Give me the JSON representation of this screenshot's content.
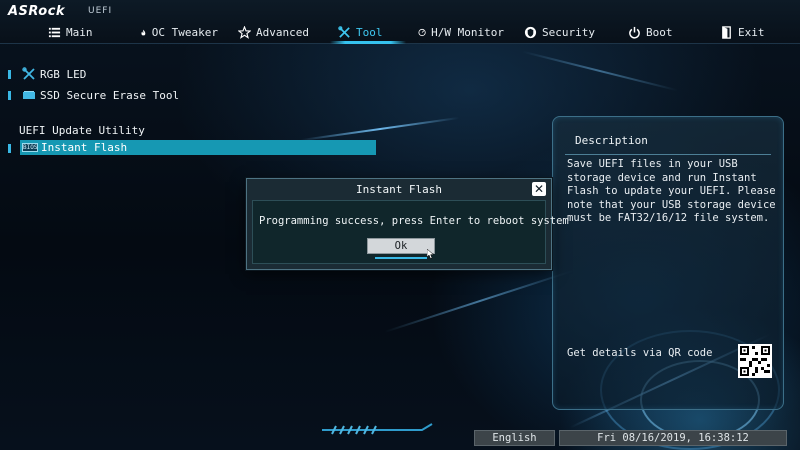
{
  "brand": {
    "name": "ASRock",
    "sub": "UEFI"
  },
  "tabs": [
    {
      "label": "Main",
      "icon": "list-icon"
    },
    {
      "label": "OC Tweaker",
      "icon": "flame-icon"
    },
    {
      "label": "Advanced",
      "icon": "star-icon"
    },
    {
      "label": "Tool",
      "icon": "tools-icon",
      "active": true
    },
    {
      "label": "H/W Monitor",
      "icon": "monitor-gauge-icon"
    },
    {
      "label": "Security",
      "icon": "shield-icon"
    },
    {
      "label": "Boot",
      "icon": "power-icon"
    },
    {
      "label": "Exit",
      "icon": "exit-door-icon"
    }
  ],
  "menu": {
    "items": [
      {
        "label": "RGB LED",
        "icon": "wrench-screwdriver-icon"
      },
      {
        "label": "SSD Secure Erase Tool",
        "icon": "ssd-icon"
      }
    ],
    "section_label": "UEFI Update Utility",
    "selected": {
      "label": "Instant Flash",
      "chip": "BIOS",
      "icon": "bios-chip-icon"
    }
  },
  "description": {
    "title": "Description",
    "body": "Save UEFI files in your USB storage device and run Instant Flash to update your UEFI. Please note that your USB storage device must be FAT32/16/12 file system.",
    "qr_label": "Get details via QR code",
    "qr_icon": "qr-code-icon"
  },
  "dialog": {
    "title": "Instant Flash",
    "close": "✕",
    "message": "Programming success, press Enter to reboot system",
    "ok_label": "Ok"
  },
  "status": {
    "language": "English",
    "datetime": "Fri 08/16/2019, 16:38:12"
  },
  "colors": {
    "accent": "#36c2ee",
    "selection": "#1698b3",
    "panel_border": "#3c6f88",
    "dialog_bg": "#1b2b34"
  }
}
